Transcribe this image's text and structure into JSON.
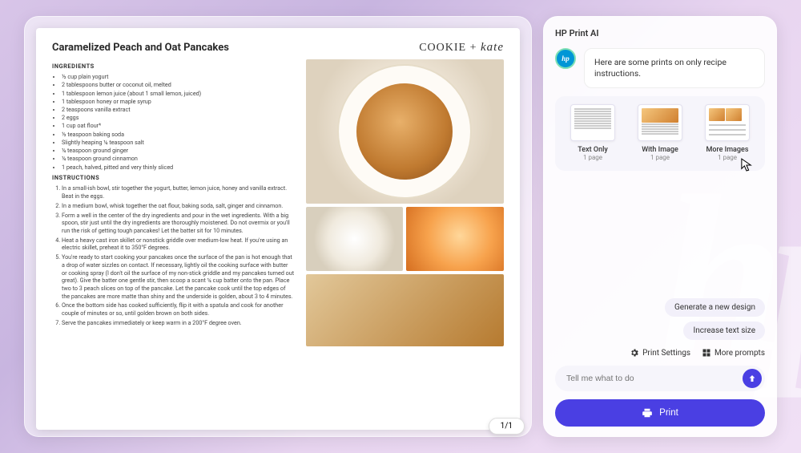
{
  "document": {
    "title": "Caramelized Peach and Oat Pancakes",
    "brand_left": "COOKIE",
    "brand_sep": "+",
    "brand_right": "kate",
    "ingredients_heading": "INGREDIENTS",
    "ingredients": [
      "½ cup plain yogurt",
      "2 tablespoons butter or coconut oil, melted",
      "1 tablespoon lemon juice (about 1 small lemon, juiced)",
      "1 tablespoon honey or maple syrup",
      "2 teaspoons vanilla extract",
      "2 eggs",
      "1 cup oat flour*",
      "½ teaspoon baking soda",
      "Slightly heaping ¼ teaspoon salt",
      "¼ teaspoon ground ginger",
      "¼ teaspoon ground cinnamon",
      "1 peach, halved, pitted and very thinly sliced"
    ],
    "instructions_heading": "INSTRUCTIONS",
    "instructions": [
      "In a small-ish bowl, stir together the yogurt, butter, lemon juice, honey and vanilla extract. Beat in the eggs.",
      "In a medium bowl, whisk together the oat flour, baking soda, salt, ginger and cinnamon.",
      "Form a well in the center of the dry ingredients and pour in the wet ingredients. With a big spoon, stir just until the dry ingredients are thoroughly moistened. Do not overmix or you'll run the risk of getting tough pancakes! Let the batter sit for 10 minutes.",
      "Heat a heavy cast iron skillet or nonstick griddle over medium-low heat. If you're using an electric skillet, preheat it to 350°F degrees.",
      "You're ready to start cooking your pancakes once the surface of the pan is hot enough that a drop of water sizzles on contact. If necessary, lightly oil the cooking surface with butter or cooking spray (I don't oil the surface of my non-stick griddle and my pancakes turned out great). Give the batter one gentle stir, then scoop a scant ¼ cup batter onto the pan. Place two to 3 peach slices on top of the pancake. Let the pancake cook until the top edges of the pancakes are more matte than shiny and the underside is golden, about 3 to 4 minutes.",
      "Once the bottom side has cooked sufficiently, flip it with a spatula and cook for another couple of minutes or so, until golden brown on both sides.",
      "Serve the pancakes immediately or keep warm in a 200°F degree oven."
    ],
    "pager": "1/1"
  },
  "ai": {
    "panel_title": "HP Print AI",
    "hp_badge": "hp",
    "message": "Here are some prints on only recipe instructions.",
    "options": [
      {
        "name": "Text Only",
        "sub": "1 page"
      },
      {
        "name": "With Image",
        "sub": "1 page"
      },
      {
        "name": "More Images",
        "sub": "1 page"
      }
    ],
    "suggestion_chips": [
      "Generate a new design",
      "Increase text size"
    ],
    "tools": {
      "print_settings": "Print Settings",
      "more_prompts": "More prompts"
    },
    "input_placeholder": "Tell me what to do",
    "print_button": "Print"
  },
  "colors": {
    "accent": "#4a3fe3",
    "hp_blue": "#0096d6"
  }
}
